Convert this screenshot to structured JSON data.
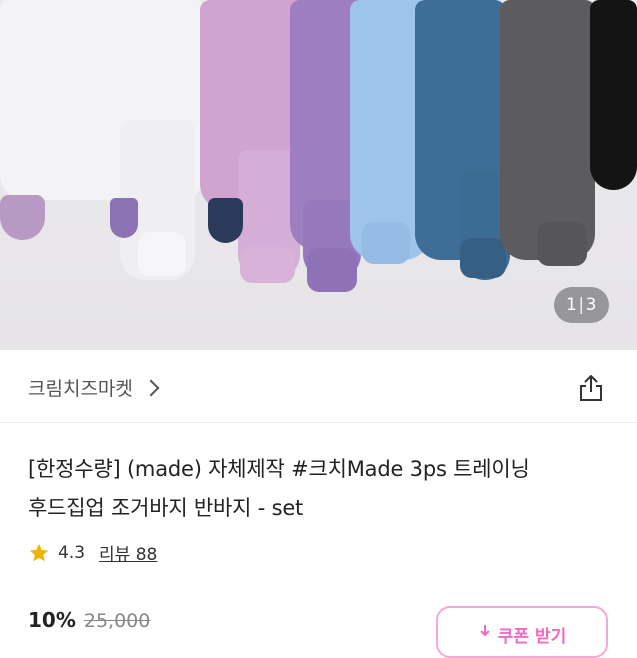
{
  "gallery": {
    "counter_current": "1",
    "counter_total": "3"
  },
  "seller": {
    "name": "크림치즈마켓"
  },
  "product": {
    "title_line1": "[한정수량] (made) 자체제작 #크치Made 3ps 트레이닝",
    "title_line2": "후드집업 조거바지 반바지 - set"
  },
  "rating": {
    "score": "4.3",
    "reviews_label": "리뷰 88"
  },
  "price": {
    "discount": "10%",
    "original": "25,000"
  },
  "coupon": {
    "label": "쿠폰 받기"
  },
  "colors": {
    "accent_pink": "#ec6cc1",
    "star": "#f0b400"
  }
}
